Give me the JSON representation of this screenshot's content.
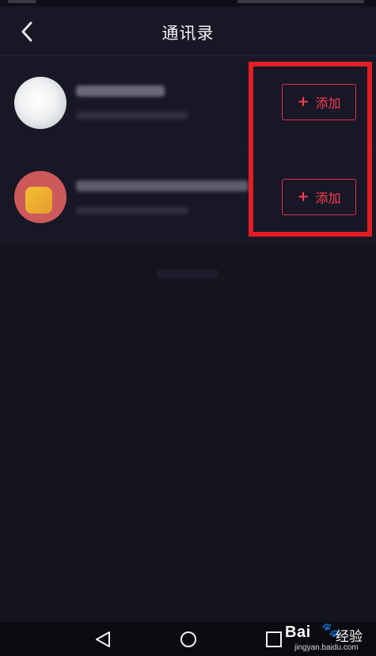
{
  "header": {
    "title": "通讯录"
  },
  "contacts": [
    {
      "add_label": "添加"
    },
    {
      "add_label": "添加"
    }
  ],
  "icons": {
    "back": "chevron-left-icon",
    "add": "plus-icon",
    "nav_back": "triangle-back-icon",
    "nav_home": "circle-home-icon",
    "nav_recent": "square-recent-icon"
  },
  "colors": {
    "background": "#14141f",
    "accent": "#ff3b55",
    "highlight": "#e31e24"
  },
  "watermark": {
    "brand": "Bai",
    "paw": "🐾",
    "suffix": "经验",
    "url": "jingyan.baidu.com"
  }
}
